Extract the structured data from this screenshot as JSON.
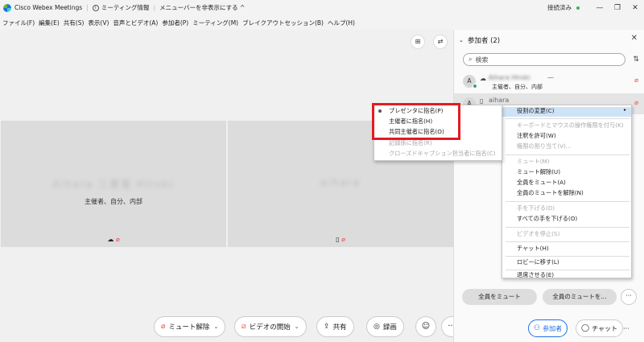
{
  "titlebar": {
    "app_title": "Cisco Webex Meetings",
    "meeting_info": "ミーティング情報",
    "hide_menu": "メニューバーを非表示にする ^",
    "connection_status": "接続済み",
    "connection_color": "#3ab54a",
    "minimize": "—",
    "restore": "❐",
    "close": "✕"
  },
  "menubar": {
    "items": [
      "ファイル(F)",
      "編集(E)",
      "共有(S)",
      "表示(V)",
      "音声とビデオ(A)",
      "参加者(P)",
      "ミーティング(M)",
      "ブレイクアウトセッション(B)",
      "ヘルプ(H)"
    ]
  },
  "stage": {
    "tile1": {
      "name": "Aihara 三菱電 Hiroki",
      "roles": "主催者、自分、内部"
    },
    "tile2": {
      "name": "aihara"
    }
  },
  "participants": {
    "title": "参加者 (2)",
    "search_placeholder": "検索",
    "rows": [
      {
        "initial": "A",
        "name": "Aihara Hiroki",
        "dash": "—",
        "roles": "主催者、自分、内部"
      },
      {
        "initial": "A",
        "name": "aihara"
      }
    ],
    "mute_all": "全員をミュート",
    "unmute_all": "全員のミュートを...",
    "more": "···"
  },
  "context_menu": {
    "items": [
      {
        "label": "役割の変更(C)",
        "disabled": false
      },
      {
        "label": "キーボードとマウスの操作権限を付与(K)",
        "disabled": true
      },
      {
        "label": "注釈を許可(W)",
        "disabled": false
      },
      {
        "label": "権限の割り当て(V)...",
        "disabled": true
      },
      {
        "label": "ミュート(M)",
        "disabled": true
      },
      {
        "label": "ミュート解除(U)",
        "disabled": false
      },
      {
        "label": "全員をミュート(A)",
        "disabled": false
      },
      {
        "label": "全員のミュートを解除(N)",
        "disabled": false
      },
      {
        "label": "手を下げる(D)",
        "disabled": true
      },
      {
        "label": "すべての手を下げる(O)",
        "disabled": false
      },
      {
        "label": "ビデオを停止(S)",
        "disabled": true
      },
      {
        "label": "チャット(H)",
        "disabled": false
      },
      {
        "label": "ロビーに移す(L)",
        "disabled": false
      },
      {
        "label": "退席させる(E)",
        "disabled": false
      }
    ]
  },
  "role_submenu": {
    "items": [
      {
        "label": "プレゼンタに指名(P)",
        "disabled": false,
        "selected": true
      },
      {
        "label": "主催者に指名(H)",
        "disabled": false
      },
      {
        "label": "共同主催者に指名(O)",
        "disabled": false
      },
      {
        "label": "記録係に指名(R)",
        "disabled": true
      },
      {
        "label": "クローズドキャプション担当者に指名(C)",
        "disabled": true
      }
    ]
  },
  "toolbar": {
    "unmute": "ミュート解除",
    "start_video": "ビデオの開始",
    "share": "共有",
    "record": "録画",
    "more": "···",
    "end_icon": "end-call-icon",
    "participants": "参加者",
    "chat": "チャット",
    "panel_more": "···"
  },
  "colors": {
    "highlight": "#e31b23",
    "end_call": "#e5402d",
    "accent": "#1f6fe5"
  }
}
